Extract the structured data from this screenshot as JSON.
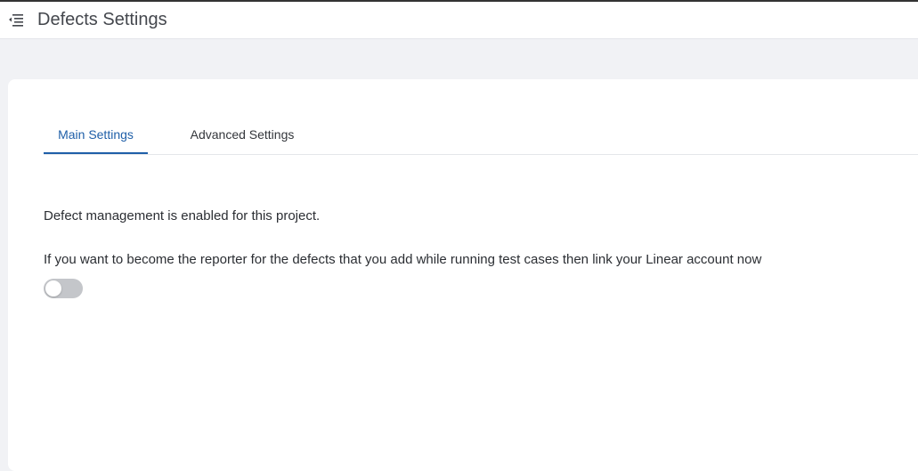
{
  "header": {
    "title": "Defects Settings",
    "menu_icon": "menu-collapse-icon"
  },
  "tabs": [
    {
      "label": "Main Settings",
      "active": true
    },
    {
      "label": "Advanced Settings",
      "active": false
    }
  ],
  "main": {
    "status_text": "Defect management is enabled for this project.",
    "link_prompt": "If you want to become the reporter for the defects that you add while running test cases then link your Linear account now",
    "link_toggle_on": false
  },
  "colors": {
    "accent": "#1f5fa8",
    "toggle_off": "#c4c6ca",
    "background": "#f1f2f5"
  }
}
